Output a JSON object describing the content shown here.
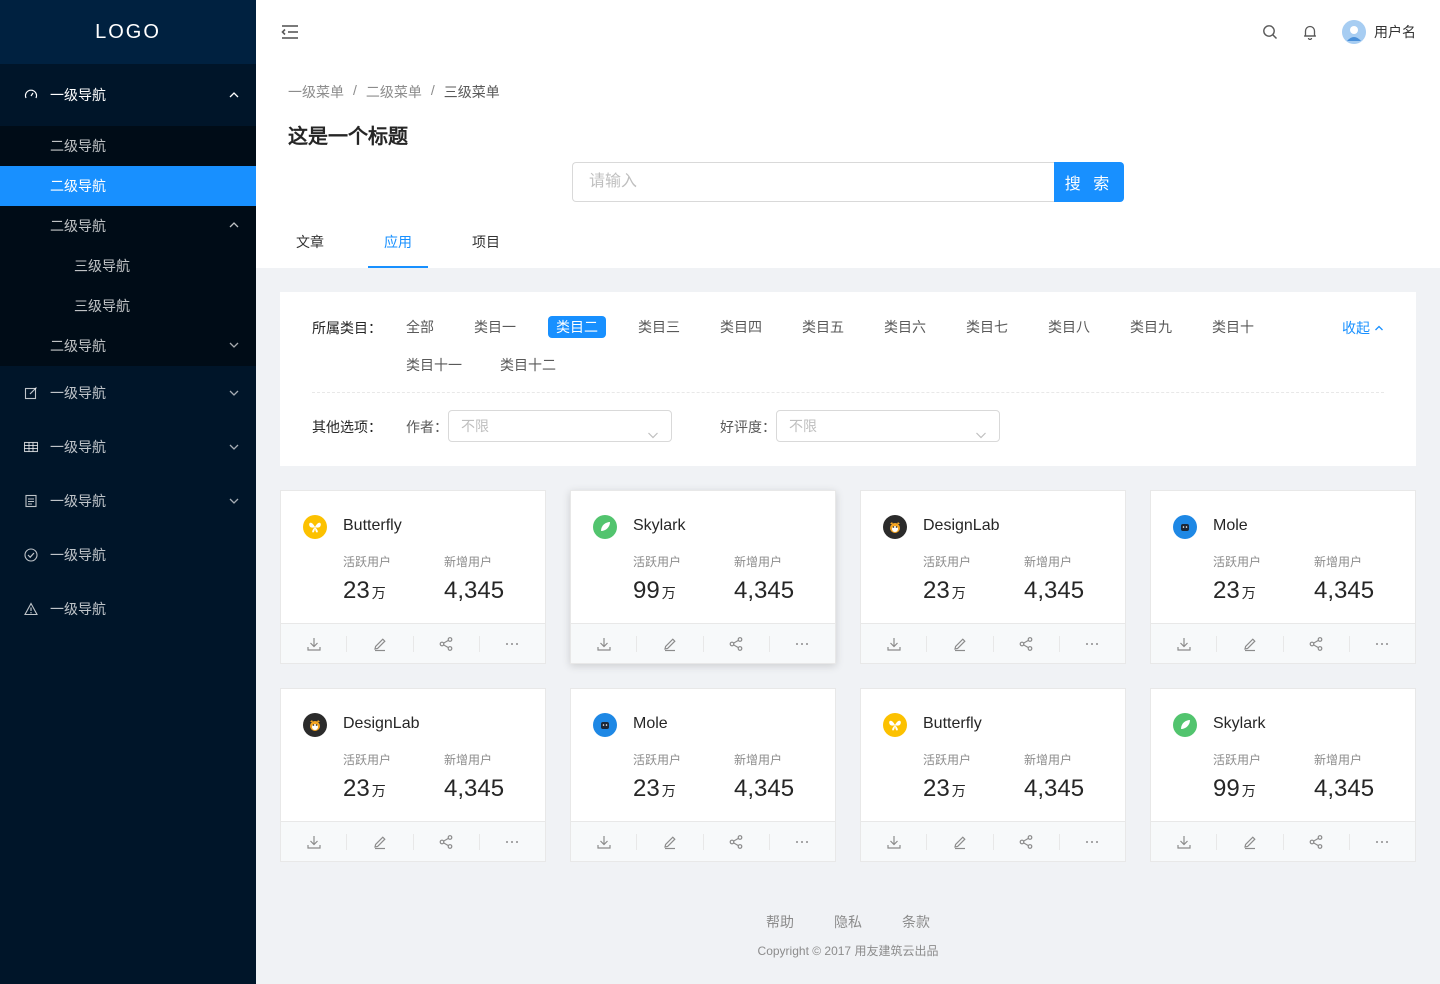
{
  "sidebar": {
    "logo": "LOGO",
    "group1": {
      "label": "一级导航",
      "subs": [
        "二级导航",
        "二级导航",
        "二级导航"
      ],
      "thirds": [
        "三级导航",
        "三级导航"
      ],
      "last_sub": "二级导航"
    },
    "items": [
      {
        "label": "一级导航",
        "icon": "edit-icon"
      },
      {
        "label": "一级导航",
        "icon": "table-icon"
      },
      {
        "label": "一级导航",
        "icon": "profile-icon"
      },
      {
        "label": "一级导航",
        "icon": "check-circle-icon"
      },
      {
        "label": "一级导航",
        "icon": "warning-icon"
      }
    ]
  },
  "header": {
    "username": "用户名"
  },
  "breadcrumb": [
    "一级菜单",
    "二级菜单",
    "三级菜单"
  ],
  "page_title": "这是一个标题",
  "search": {
    "placeholder": "请输入",
    "button": "搜 索"
  },
  "tabs": [
    "文章",
    "应用",
    "项目"
  ],
  "filter": {
    "category_label": "所属类目：",
    "categories": [
      "全部",
      "类目一",
      "类目二",
      "类目三",
      "类目四",
      "类目五",
      "类目六",
      "类目七",
      "类目八",
      "类目九",
      "类目十",
      "类目十一",
      "类目十二"
    ],
    "active_category": "类目二",
    "collapse": "收起",
    "other_label": "其他选项：",
    "author_label": "作者：",
    "author_value": "不限",
    "rating_label": "好评度：",
    "rating_value": "不限"
  },
  "cards": [
    {
      "name": "Butterfly",
      "active_label": "活跃用户",
      "active": "23",
      "unit": "万",
      "new_label": "新增用户",
      "new": "4,345",
      "icon": "butterfly",
      "color": "#fcc100"
    },
    {
      "name": "Skylark",
      "active_label": "活跃用户",
      "active": "99",
      "unit": "万",
      "new_label": "新增用户",
      "new": "4,345",
      "icon": "skylark",
      "color": "#52c46e"
    },
    {
      "name": "DesignLab",
      "active_label": "活跃用户",
      "active": "23",
      "unit": "万",
      "new_label": "新增用户",
      "new": "4,345",
      "icon": "designlab",
      "color": "#2b2b2b"
    },
    {
      "name": "Mole",
      "active_label": "活跃用户",
      "active": "23",
      "unit": "万",
      "new_label": "新增用户",
      "new": "4,345",
      "icon": "mole",
      "color": "#1e88e5"
    },
    {
      "name": "DesignLab",
      "active_label": "活跃用户",
      "active": "23",
      "unit": "万",
      "new_label": "新增用户",
      "new": "4,345",
      "icon": "designlab",
      "color": "#2b2b2b"
    },
    {
      "name": "Mole",
      "active_label": "活跃用户",
      "active": "23",
      "unit": "万",
      "new_label": "新增用户",
      "new": "4,345",
      "icon": "mole",
      "color": "#1e88e5"
    },
    {
      "name": "Butterfly",
      "active_label": "活跃用户",
      "active": "23",
      "unit": "万",
      "new_label": "新增用户",
      "new": "4,345",
      "icon": "butterfly",
      "color": "#fcc100"
    },
    {
      "name": "Skylark",
      "active_label": "活跃用户",
      "active": "99",
      "unit": "万",
      "new_label": "新增用户",
      "new": "4,345",
      "icon": "skylark",
      "color": "#52c46e"
    }
  ],
  "footer": {
    "links": [
      "帮助",
      "隐私",
      "条款"
    ],
    "copyright": "Copyright © 2017 用友建筑云出品"
  },
  "colors": {
    "primary": "#1890ff",
    "sidebar_bg": "#001529",
    "submenu_bg": "#000c17"
  }
}
